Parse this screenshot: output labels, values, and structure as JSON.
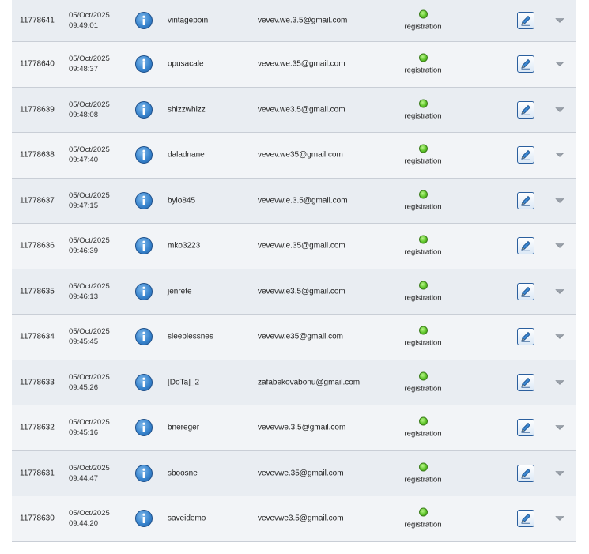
{
  "rows": [
    {
      "id": "11778641",
      "date": "05/Oct/2025",
      "time": "09:49:01",
      "username": "vintagepoin",
      "email": "vevev.we.3.5@gmail.com",
      "status": "registration"
    },
    {
      "id": "11778640",
      "date": "05/Oct/2025",
      "time": "09:48:37",
      "username": "opusacale",
      "email": "vevev.we.35@gmail.com",
      "status": "registration"
    },
    {
      "id": "11778639",
      "date": "05/Oct/2025",
      "time": "09:48:08",
      "username": "shizzwhizz",
      "email": "vevev.we3.5@gmail.com",
      "status": "registration"
    },
    {
      "id": "11778638",
      "date": "05/Oct/2025",
      "time": "09:47:40",
      "username": "daladnane",
      "email": "vevev.we35@gmail.com",
      "status": "registration"
    },
    {
      "id": "11778637",
      "date": "05/Oct/2025",
      "time": "09:47:15",
      "username": "bylo845",
      "email": "vevevw.e.3.5@gmail.com",
      "status": "registration"
    },
    {
      "id": "11778636",
      "date": "05/Oct/2025",
      "time": "09:46:39",
      "username": "mko3223",
      "email": "vevevw.e.35@gmail.com",
      "status": "registration"
    },
    {
      "id": "11778635",
      "date": "05/Oct/2025",
      "time": "09:46:13",
      "username": "jenrete",
      "email": "vevevw.e3.5@gmail.com",
      "status": "registration"
    },
    {
      "id": "11778634",
      "date": "05/Oct/2025",
      "time": "09:45:45",
      "username": "sleeplessnes",
      "email": "vevevw.e35@gmail.com",
      "status": "registration"
    },
    {
      "id": "11778633",
      "date": "05/Oct/2025",
      "time": "09:45:26",
      "username": "[DoTa]_2",
      "email": "zafabekovabonu@gmail.com",
      "status": "registration"
    },
    {
      "id": "11778632",
      "date": "05/Oct/2025",
      "time": "09:45:16",
      "username": "bnereger",
      "email": "vevevwe.3.5@gmail.com",
      "status": "registration"
    },
    {
      "id": "11778631",
      "date": "05/Oct/2025",
      "time": "09:44:47",
      "username": "sboosne",
      "email": "vevevwe.35@gmail.com",
      "status": "registration"
    },
    {
      "id": "11778630",
      "date": "05/Oct/2025",
      "time": "09:44:20",
      "username": "saveidemo",
      "email": "vevevwe3.5@gmail.com",
      "status": "registration"
    }
  ],
  "icons": {
    "info": "info-icon",
    "status": "status-dot-icon",
    "edit": "edit-pencil-icon",
    "expand": "chevron-down-icon"
  },
  "colors": {
    "status_green": "#5fc62a",
    "info_blue": "#3a86cf",
    "edit_border": "#2b5f9e"
  }
}
